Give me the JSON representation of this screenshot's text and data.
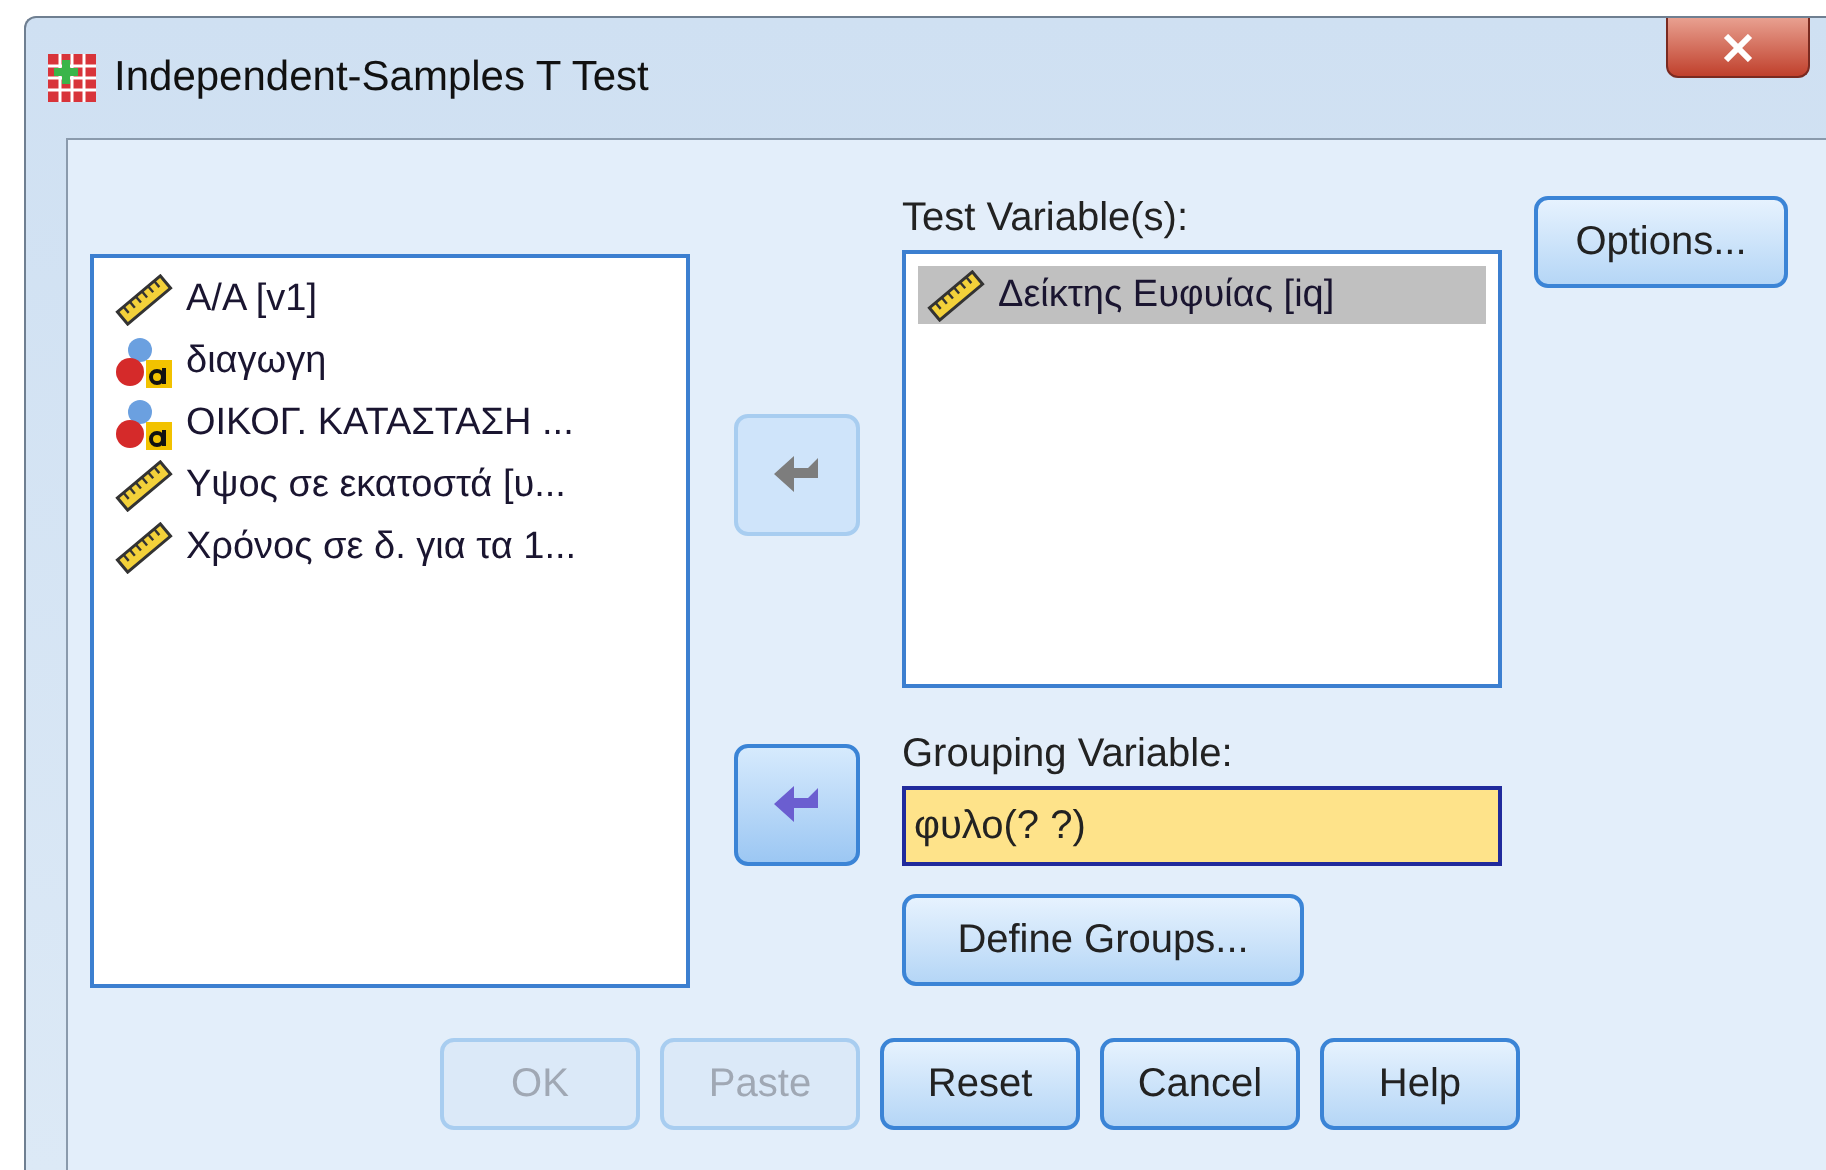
{
  "window": {
    "title": "Independent-Samples T Test"
  },
  "source_variables": [
    {
      "label": "Α/Α [v1]",
      "kind": "scale",
      "selected": false
    },
    {
      "label": "διαγωγη",
      "kind": "nominal",
      "selected": false
    },
    {
      "label": "ΟΙΚΟΓ. ΚΑΤΑΣΤΑΣΗ ...",
      "kind": "nominal",
      "selected": false
    },
    {
      "label": "Υψος σε εκατοστά [υ...",
      "kind": "scale",
      "selected": false
    },
    {
      "label": "Χρόνος σε δ. για τα 1...",
      "kind": "scale",
      "selected": false
    }
  ],
  "move_test_button": {
    "disabled": true
  },
  "test_variables": {
    "label": "Test Variable(s):",
    "items": [
      {
        "label": "Δείκτης Ευφυίας [iq]",
        "kind": "scale",
        "selected": true
      }
    ]
  },
  "move_grouping_button": {
    "disabled": false
  },
  "grouping_variable": {
    "label": "Grouping Variable:",
    "value": "φυλο(? ?)"
  },
  "define_groups_button": "Define Groups...",
  "options_button": "Options...",
  "buttons": [
    {
      "label": "OK",
      "disabled": true
    },
    {
      "label": "Paste",
      "disabled": true
    },
    {
      "label": "Reset",
      "disabled": false
    },
    {
      "label": "Cancel",
      "disabled": false
    },
    {
      "label": "Help",
      "disabled": false
    }
  ]
}
